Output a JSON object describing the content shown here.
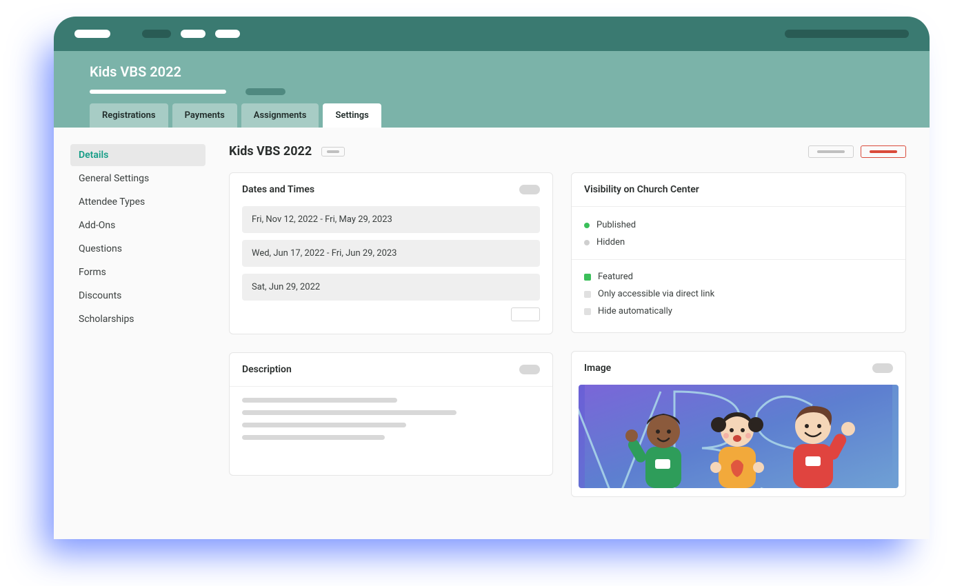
{
  "header": {
    "title": "Kids VBS 2022"
  },
  "tabs": [
    {
      "label": "Registrations",
      "active": false
    },
    {
      "label": "Payments",
      "active": false
    },
    {
      "label": "Assignments",
      "active": false
    },
    {
      "label": "Settings",
      "active": true
    }
  ],
  "sidebar": [
    {
      "label": "Details",
      "active": true
    },
    {
      "label": "General Settings",
      "active": false
    },
    {
      "label": "Attendee Types",
      "active": false
    },
    {
      "label": "Add-Ons",
      "active": false
    },
    {
      "label": "Questions",
      "active": false
    },
    {
      "label": "Forms",
      "active": false
    },
    {
      "label": "Discounts",
      "active": false
    },
    {
      "label": "Scholarships",
      "active": false
    }
  ],
  "page": {
    "title": "Kids VBS 2022"
  },
  "dates_card": {
    "title": "Dates and Times",
    "rows": [
      "Fri, Nov 12, 2022 - Fri, May 29, 2023",
      "Wed, Jun 17, 2022 - Fri, Jun 29, 2023",
      "Sat, Jun 29, 2022"
    ]
  },
  "description_card": {
    "title": "Description"
  },
  "visibility_card": {
    "title": "Visibility on Church Center",
    "status": [
      {
        "label": "Published",
        "state": "green"
      },
      {
        "label": "Hidden",
        "state": "gray"
      }
    ],
    "options": [
      {
        "label": "Featured",
        "state": "green"
      },
      {
        "label": "Only accessible via direct link",
        "state": "gray"
      },
      {
        "label": "Hide automatically",
        "state": "gray"
      }
    ]
  },
  "image_card": {
    "title": "Image"
  }
}
